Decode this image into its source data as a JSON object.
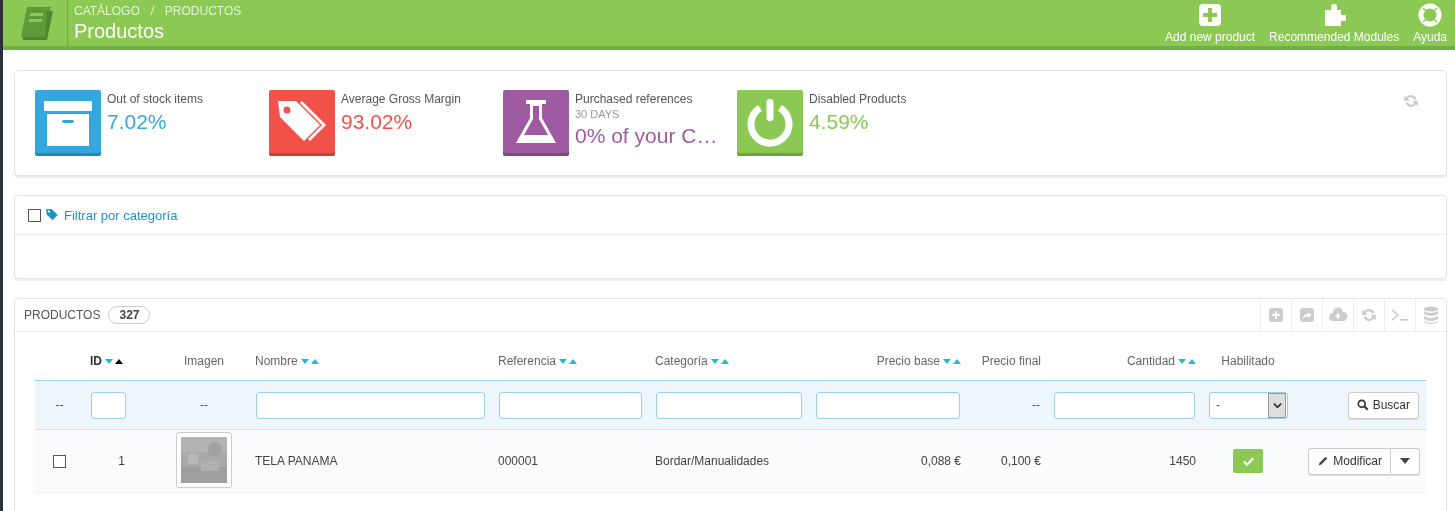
{
  "header": {
    "breadcrumb": [
      "CATÁLOGO",
      "PRODUCTOS"
    ],
    "title": "Productos",
    "actions": [
      {
        "kind": "add",
        "label": "Add new product"
      },
      {
        "kind": "modules",
        "label": "Recommended Modules"
      },
      {
        "kind": "help",
        "label": "Ayuda"
      }
    ]
  },
  "kpis": [
    {
      "kind": "stock",
      "label": "Out of stock items",
      "value": "7.02%",
      "color": "#34a8dc"
    },
    {
      "kind": "margin",
      "label": "Average Gross Margin",
      "value": "93.02%",
      "color": "#f2524a"
    },
    {
      "kind": "references",
      "label": "Purchased references",
      "sublabel": "30 DAYS",
      "value": "0% of your C…",
      "color": "#9e5ba1"
    },
    {
      "kind": "disabled",
      "label": "Disabled Products",
      "value": "4.59%",
      "color": "#8bc954"
    }
  ],
  "category_filter": {
    "label": "Filtrar por categoría",
    "checked": false
  },
  "products": {
    "title": "PRODUCTOS",
    "count": "327",
    "columns": [
      {
        "label": "ID",
        "sortable": true,
        "sorted_ascending": true
      },
      {
        "label": "Imagen",
        "sortable": false
      },
      {
        "label": "Nombre",
        "sortable": true,
        "sorted_ascending": false
      },
      {
        "label": "Referencia",
        "sortable": true,
        "sorted_ascending": false
      },
      {
        "label": "Categoría",
        "sortable": true,
        "sorted_ascending": false
      },
      {
        "label": "Precio base",
        "sortable": true,
        "sorted_ascending": false
      },
      {
        "label": "Precio final",
        "sortable": false
      },
      {
        "label": "Cantidad",
        "sortable": true,
        "sorted_ascending": false
      },
      {
        "label": "Habilitado",
        "sortable": false
      }
    ],
    "filters": [
      {
        "kind": "dash",
        "text": "--"
      },
      {
        "kind": "input"
      },
      {
        "kind": "dash",
        "text": "--"
      },
      {
        "kind": "input"
      },
      {
        "kind": "input"
      },
      {
        "kind": "input"
      },
      {
        "kind": "input"
      },
      {
        "kind": "dash",
        "text": "--"
      },
      {
        "kind": "input"
      },
      {
        "kind": "select",
        "value": "-"
      },
      {
        "kind": "button",
        "text": "Buscar"
      }
    ],
    "rows": [
      {
        "checked": false,
        "id": "1",
        "name": "TELA PANAMA",
        "reference": "000001",
        "category": "Bordar/Manualidades",
        "base_price": "0,088 €",
        "final_price": "0,100 €",
        "quantity": "1450",
        "enabled": true,
        "action": "Modificar"
      }
    ]
  }
}
